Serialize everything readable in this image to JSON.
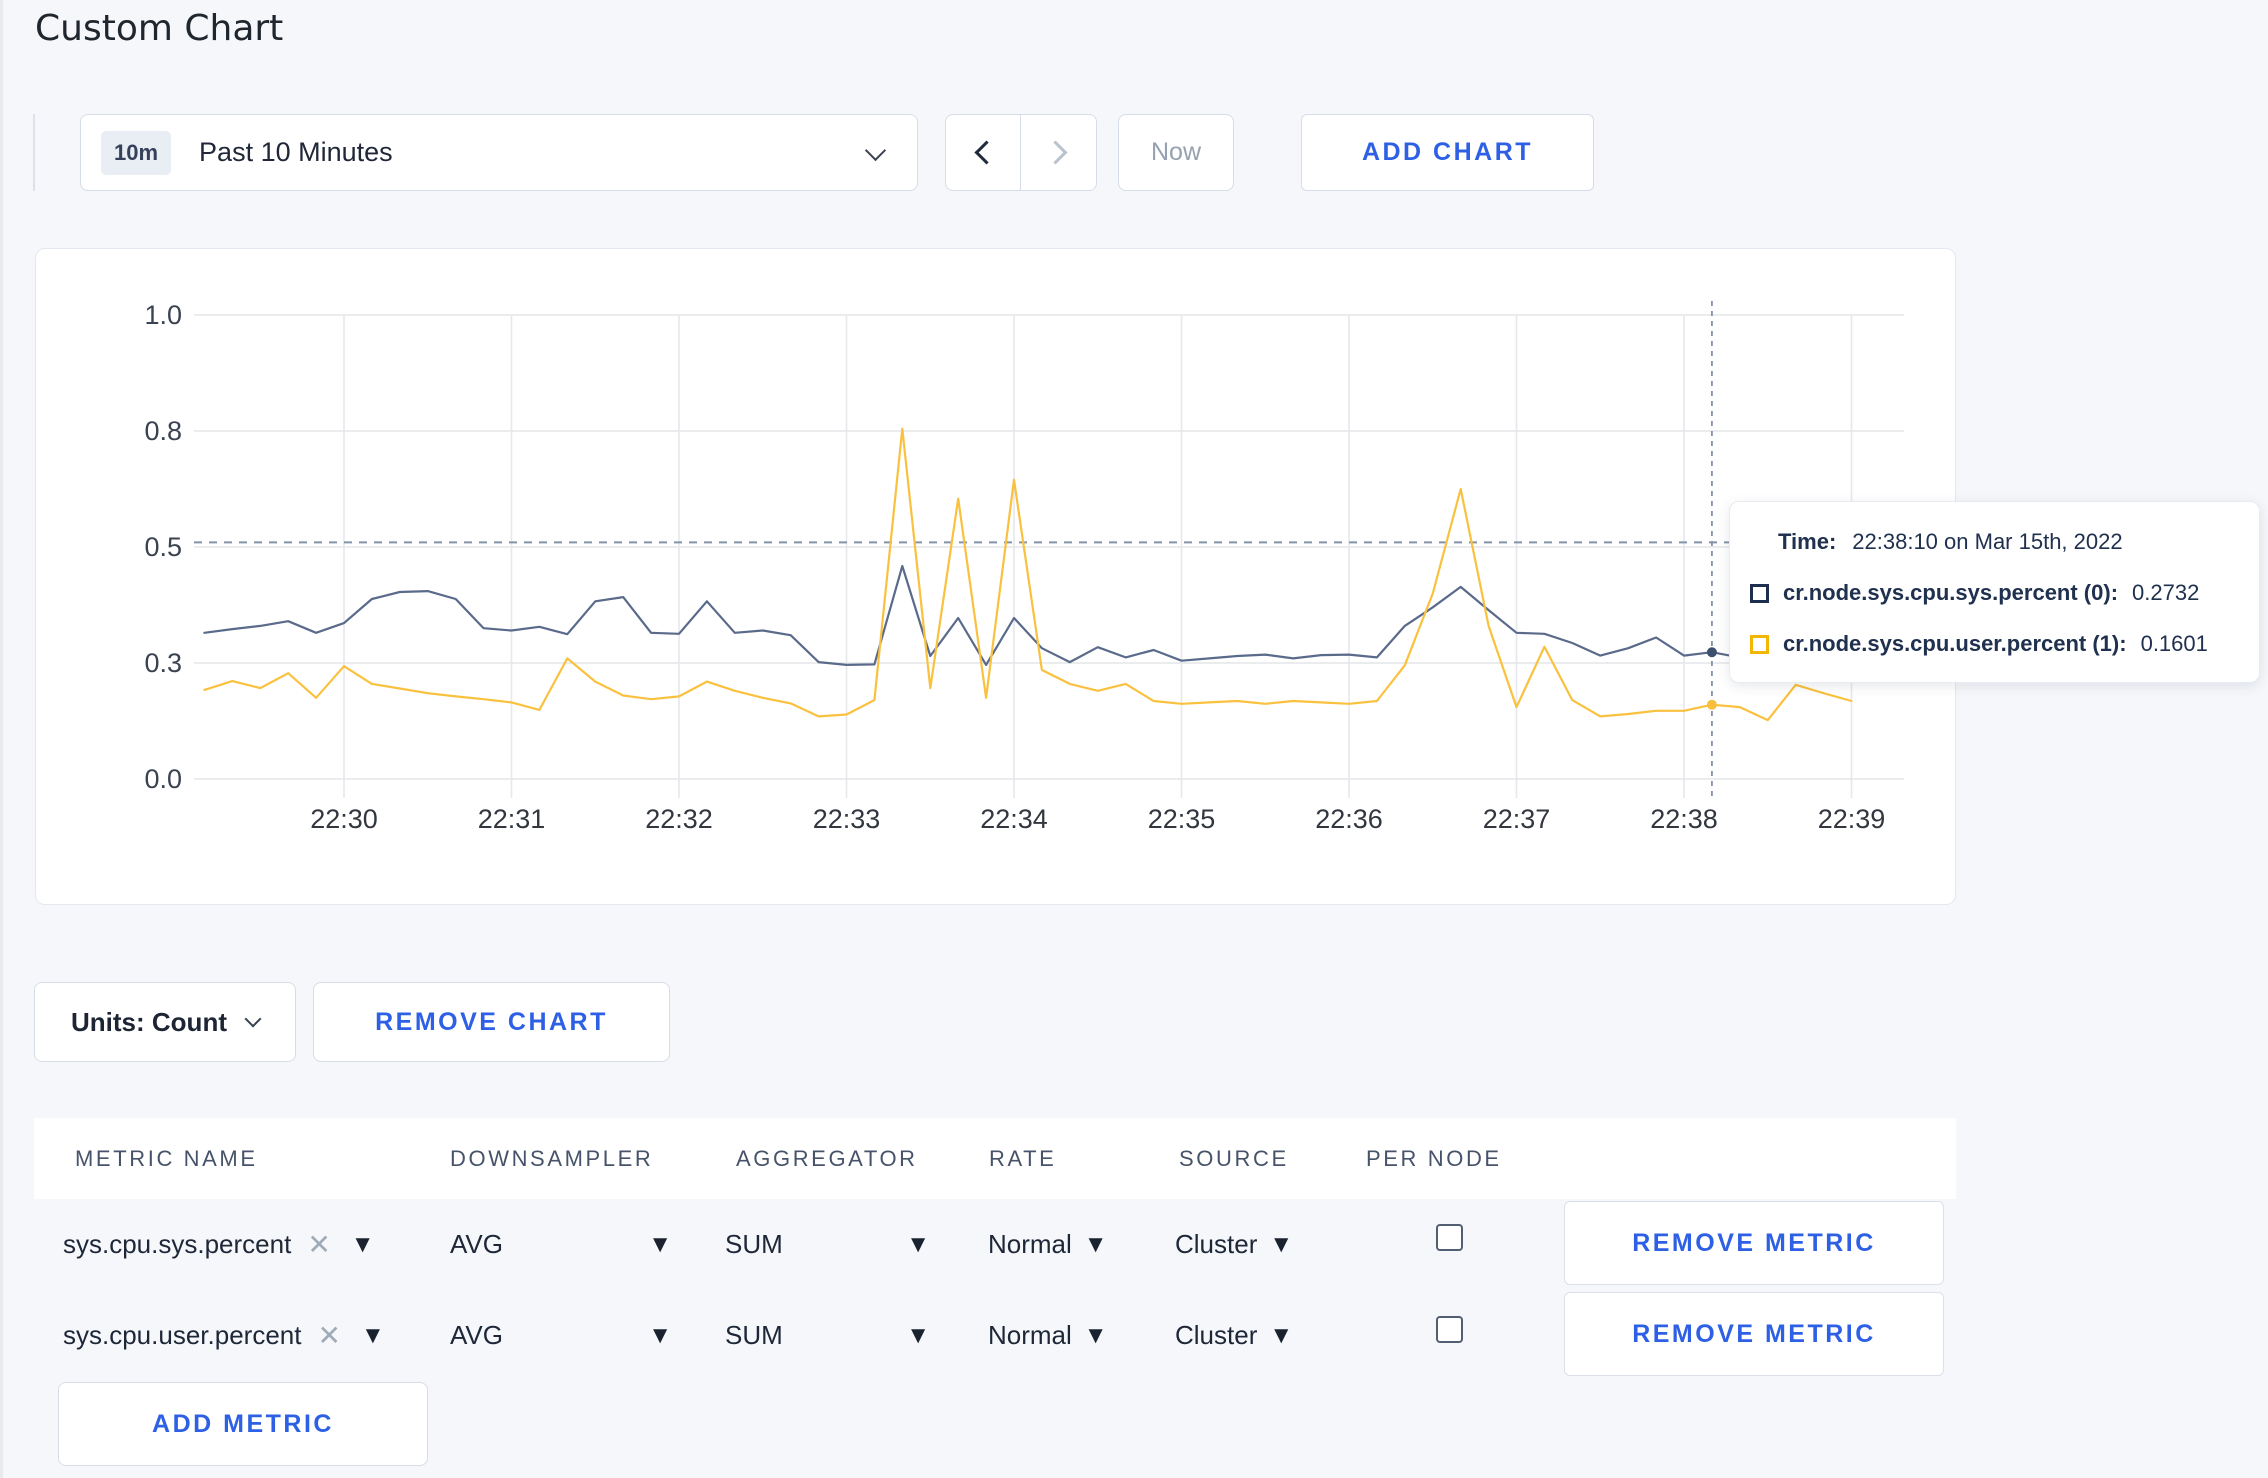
{
  "page": {
    "title": "Custom Chart",
    "background": "#f5f7fa",
    "accent_blue": "#2e60e5"
  },
  "toolbar": {
    "time_window_badge": "10m",
    "time_window_label": "Past 10 Minutes",
    "now_label": "Now",
    "add_chart_label": "ADD CHART"
  },
  "chart_data": {
    "type": "line",
    "title": "",
    "x_axis": {
      "tick_minutes": [
        30,
        31,
        32,
        33,
        34,
        35,
        36,
        37,
        38,
        39
      ],
      "tick_labels": [
        "22:30",
        "22:31",
        "22:32",
        "22:33",
        "22:34",
        "22:35",
        "22:36",
        "22:37",
        "22:38",
        "22:39"
      ],
      "start_minute": 29.166667,
      "step_minutes": 0.166667
    },
    "y_axis": {
      "ticks": [
        0,
        0.25,
        0.5,
        0.75,
        1
      ],
      "labels": [
        "0.0",
        "0.3",
        "0.5",
        "0.8",
        "1.0"
      ],
      "range": [
        0,
        1
      ]
    },
    "reference_line_value": 0.51,
    "grid": true,
    "legend_position": "tooltip",
    "series": [
      {
        "name": "cr.node.sys.cpu.sys.percent",
        "color": "#5a6a8a",
        "swatch": "#1f2d4e",
        "values": [
          0.315,
          0.323,
          0.33,
          0.34,
          0.315,
          0.336,
          0.388,
          0.403,
          0.405,
          0.388,
          0.325,
          0.32,
          0.328,
          0.312,
          0.383,
          0.392,
          0.315,
          0.313,
          0.383,
          0.315,
          0.32,
          0.31,
          0.252,
          0.246,
          0.247,
          0.459,
          0.265,
          0.347,
          0.246,
          0.347,
          0.282,
          0.252,
          0.284,
          0.262,
          0.278,
          0.255,
          0.26,
          0.265,
          0.268,
          0.26,
          0.267,
          0.268,
          0.262,
          0.33,
          0.37,
          0.414,
          0.364,
          0.315,
          0.313,
          0.293,
          0.266,
          0.282,
          0.305,
          0.266,
          0.2732,
          0.262,
          0.272,
          0.282,
          0.275,
          0.272
        ]
      },
      {
        "name": "cr.node.sys.cpu.user.percent",
        "color": "#f9c13e",
        "swatch": "#f2b705",
        "values": [
          0.192,
          0.211,
          0.196,
          0.228,
          0.175,
          0.243,
          0.205,
          0.195,
          0.185,
          0.178,
          0.172,
          0.165,
          0.149,
          0.26,
          0.21,
          0.18,
          0.172,
          0.178,
          0.21,
          0.19,
          0.175,
          0.163,
          0.135,
          0.139,
          0.17,
          0.755,
          0.196,
          0.604,
          0.175,
          0.645,
          0.235,
          0.205,
          0.19,
          0.205,
          0.168,
          0.162,
          0.165,
          0.168,
          0.162,
          0.168,
          0.165,
          0.162,
          0.168,
          0.245,
          0.4,
          0.625,
          0.33,
          0.155,
          0.285,
          0.17,
          0.135,
          0.14,
          0.147,
          0.147,
          0.1601,
          0.155,
          0.127,
          0.203,
          0.185,
          0.168
        ]
      }
    ],
    "hover": {
      "minute": 38.166667,
      "time_label": "Time:",
      "time_value": "22:38:10 on Mar 15th, 2022",
      "rows": [
        {
          "label": "cr.node.sys.cpu.sys.percent (0):",
          "value": "0.2732",
          "v": 0.2732,
          "swatch": "#1f2d4e"
        },
        {
          "label": "cr.node.sys.cpu.user.percent (1):",
          "value": "0.1601",
          "v": 0.1601,
          "swatch": "#f2b705"
        }
      ]
    }
  },
  "chart_footer": {
    "units_label": "Units: Count",
    "remove_chart_label": "REMOVE CHART"
  },
  "metrics_table": {
    "headers": {
      "metric": "METRIC NAME",
      "downsampler": "DOWNSAMPLER",
      "aggregator": "AGGREGATOR",
      "rate": "RATE",
      "source": "SOURCE",
      "per_node": "PER NODE"
    },
    "rows": [
      {
        "metric": "sys.cpu.sys.percent",
        "downsampler": "AVG",
        "aggregator": "SUM",
        "rate": "Normal",
        "source": "Cluster",
        "per_node_checked": false
      },
      {
        "metric": "sys.cpu.user.percent",
        "downsampler": "AVG",
        "aggregator": "SUM",
        "rate": "Normal",
        "source": "Cluster",
        "per_node_checked": false
      }
    ],
    "remove_metric_label": "REMOVE METRIC",
    "add_metric_label": "ADD METRIC"
  }
}
